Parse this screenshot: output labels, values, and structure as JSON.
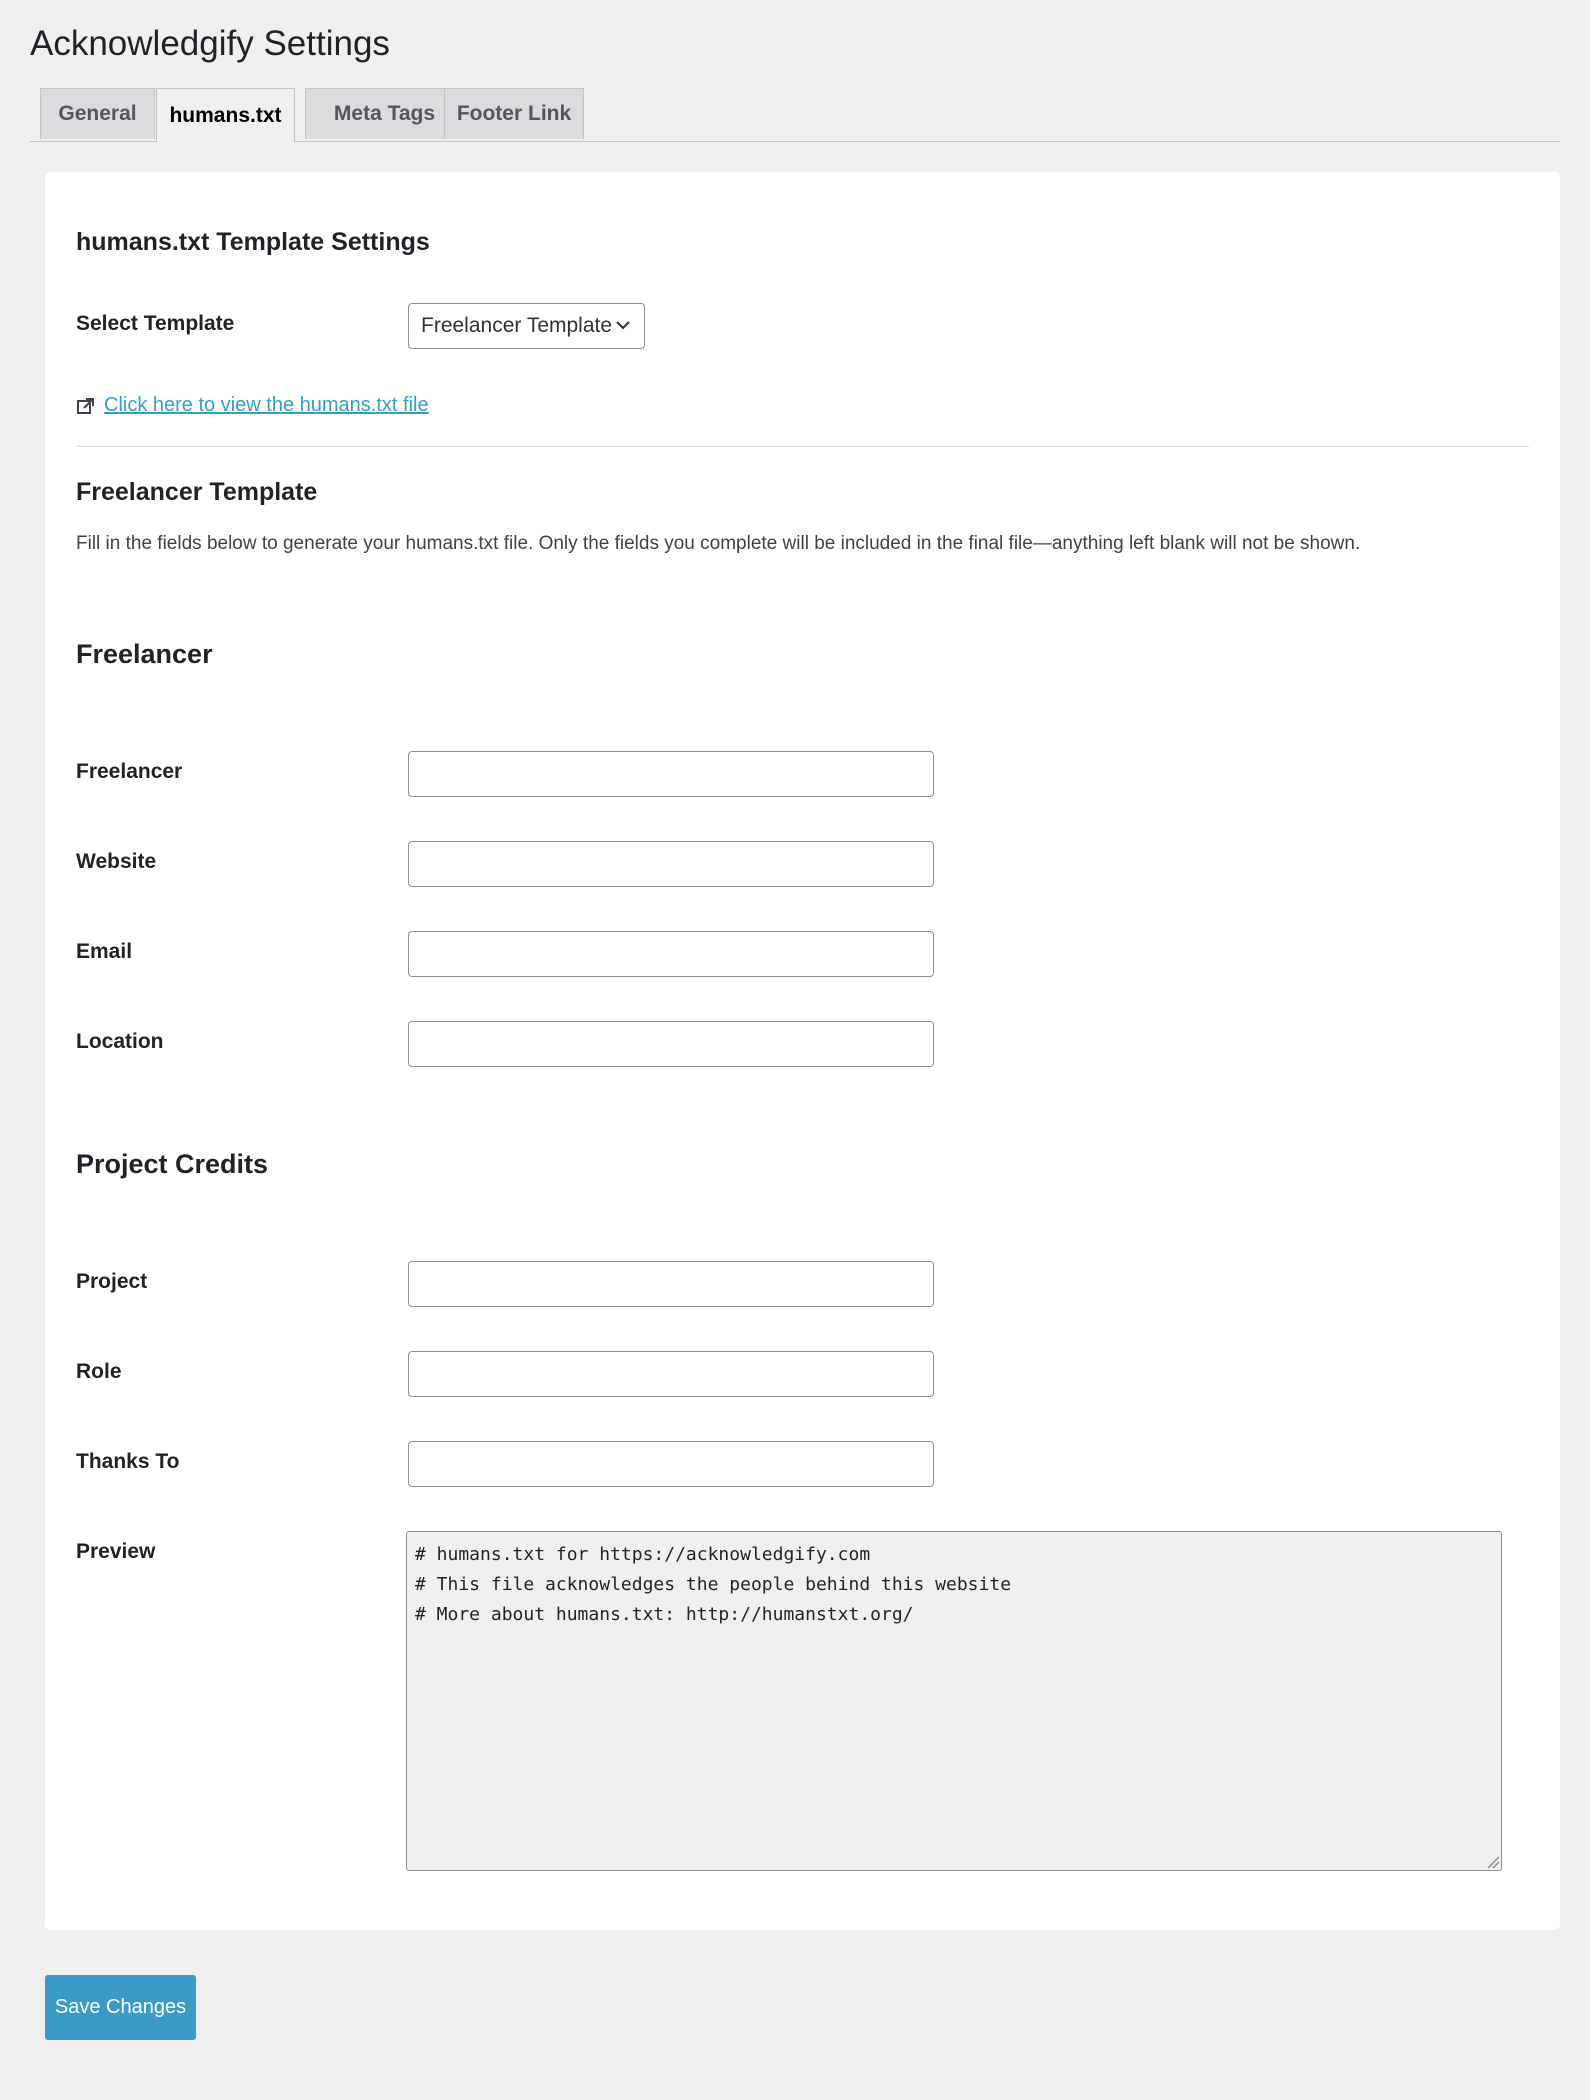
{
  "page": {
    "title": "Acknowledgify Settings"
  },
  "tabs": [
    {
      "label": "General",
      "active": false
    },
    {
      "label": "humans.txt",
      "active": true
    },
    {
      "label": "Meta Tags",
      "active": false
    },
    {
      "label": "Footer Link",
      "active": false
    }
  ],
  "template_settings": {
    "heading": "humans.txt Template Settings",
    "select_label": "Select Template",
    "select_value": "Freelancer Template",
    "view_link": "Click here to view the humans.txt file",
    "link_icon": "external-link-icon"
  },
  "template_section": {
    "heading": "Freelancer Template",
    "description": "Fill in the fields below to generate your humans.txt file. Only the fields you complete will be included in the final file—anything left blank will not be shown."
  },
  "freelancer": {
    "heading": "Freelancer",
    "fields": [
      {
        "label": "Freelancer",
        "value": ""
      },
      {
        "label": "Website",
        "value": ""
      },
      {
        "label": "Email",
        "value": ""
      },
      {
        "label": "Location",
        "value": ""
      }
    ]
  },
  "project_credits": {
    "heading": "Project Credits",
    "fields": [
      {
        "label": "Project",
        "value": ""
      },
      {
        "label": "Role",
        "value": ""
      },
      {
        "label": "Thanks To",
        "value": ""
      }
    ]
  },
  "preview": {
    "label": "Preview",
    "text": "# humans.txt for https://acknowledgify.com\n# This file acknowledges the people behind this website\n# More about humans.txt: http://humanstxt.org/"
  },
  "actions": {
    "save_label": "Save Changes"
  },
  "colors": {
    "accent": "#3a9bc7",
    "link": "#2ea2cc",
    "background": "#f0f0f1",
    "card": "#ffffff"
  }
}
